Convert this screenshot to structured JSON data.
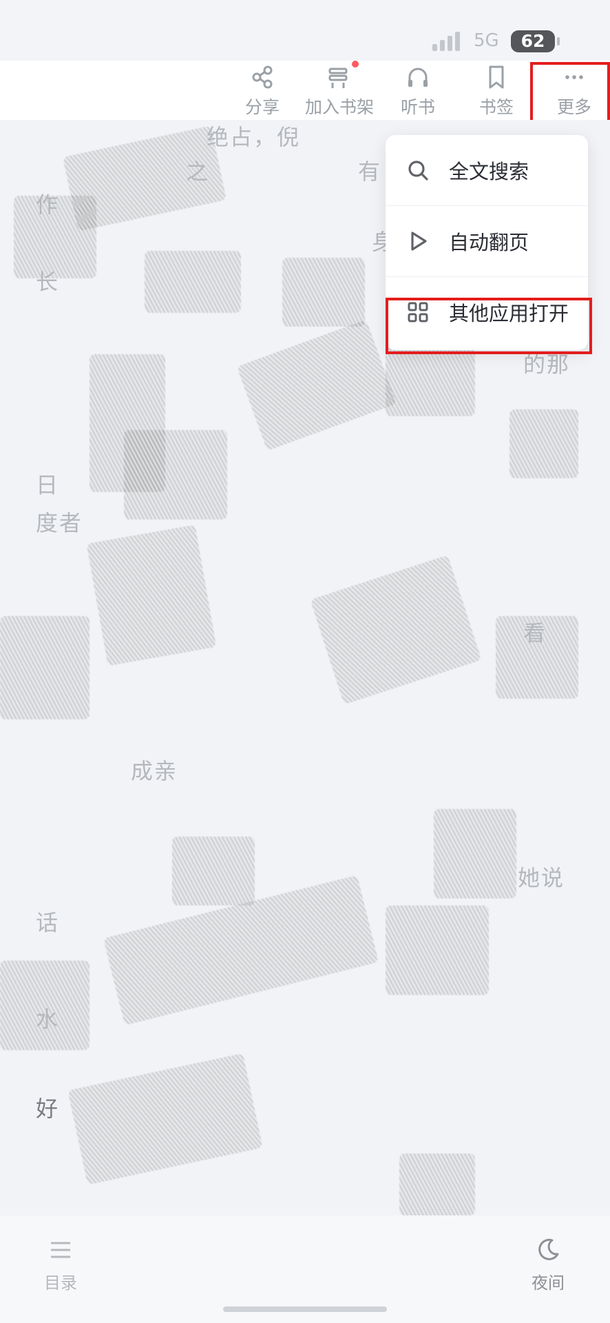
{
  "status_bar": {
    "network": "5G",
    "battery": "62"
  },
  "toolbar": {
    "share_label": "分享",
    "add_shelf_label": "加入书架",
    "listen_label": "听书",
    "bookmark_label": "书签",
    "more_label": "更多"
  },
  "menu": {
    "items": [
      {
        "label": "全文搜索",
        "icon": "search-icon"
      },
      {
        "label": "自动翻页",
        "icon": "play-icon"
      },
      {
        "label": "其他应用打开",
        "icon": "grid-icon"
      }
    ]
  },
  "reader": {
    "fragments": [
      "绝占，倪",
      "之",
      "有",
      "作",
      "身",
      "长",
      "的那",
      "日",
      "度者",
      "看",
      "成亲",
      "她说",
      "话",
      "水",
      "好"
    ]
  },
  "bottom_bar": {
    "catalog_label": "目录",
    "night_label": "夜间"
  },
  "colors": {
    "highlight": "#e41d1d",
    "accent_dot": "#ff5a5f"
  }
}
